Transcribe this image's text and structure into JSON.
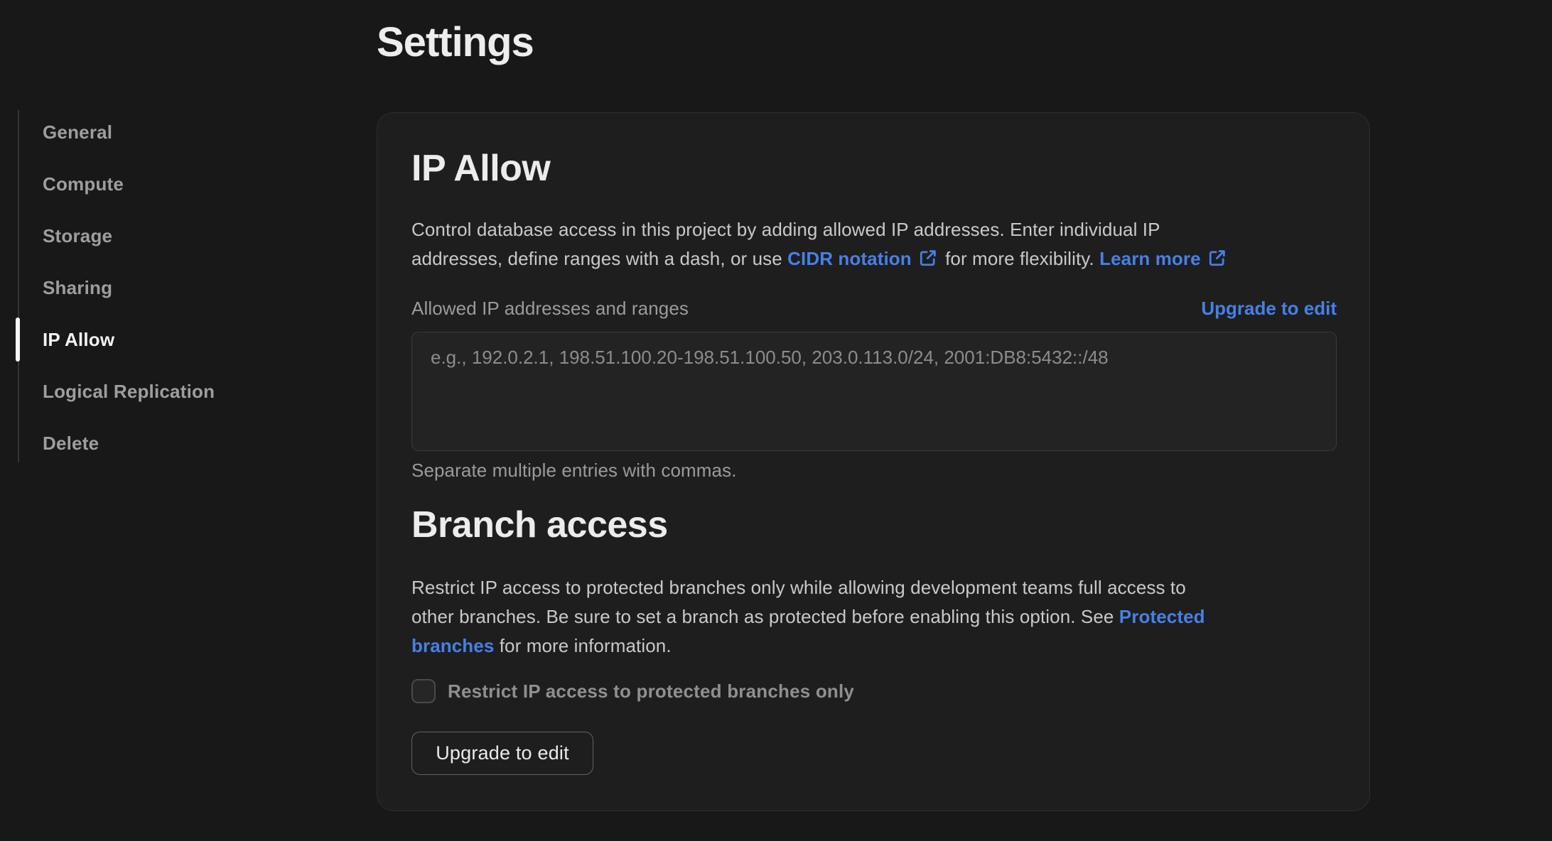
{
  "page": {
    "title": "Settings"
  },
  "colors": {
    "accent_blue": "#4680e8",
    "background": "#181818",
    "card_background": "#1e1e1e"
  },
  "sidebar": {
    "items": [
      {
        "label": "General",
        "active": false
      },
      {
        "label": "Compute",
        "active": false
      },
      {
        "label": "Storage",
        "active": false
      },
      {
        "label": "Sharing",
        "active": false
      },
      {
        "label": "IP Allow",
        "active": true
      },
      {
        "label": "Logical Replication",
        "active": false
      },
      {
        "label": "Delete",
        "active": false
      }
    ]
  },
  "card": {
    "ip_allow": {
      "heading": "IP Allow",
      "desc_part1": "Control database access in this project by adding allowed IP addresses. Enter individual IP\naddresses, define ranges with a dash, or use ",
      "cidr_link": "CIDR notation",
      "desc_part2": " for more flexibility. ",
      "learn_more_link": "Learn more",
      "field_label": "Allowed IP addresses and ranges",
      "upgrade_link": "Upgrade to edit",
      "placeholder": "e.g., 192.0.2.1, 198.51.100.20-198.51.100.50, 203.0.113.0/24, 2001:DB8:5432::/48",
      "helper": "Separate multiple entries with commas."
    },
    "branch_access": {
      "heading": "Branch access",
      "desc_part1": "Restrict IP access to protected branches only while allowing development teams full access to\nother branches. Be sure to set a branch as protected before enabling this option. See ",
      "protected_link": "Protected\nbranches",
      "desc_part2": " for more information.",
      "checkbox_label": "Restrict IP access to protected branches only",
      "checkbox_checked": false,
      "button_label": "Upgrade to edit"
    }
  }
}
